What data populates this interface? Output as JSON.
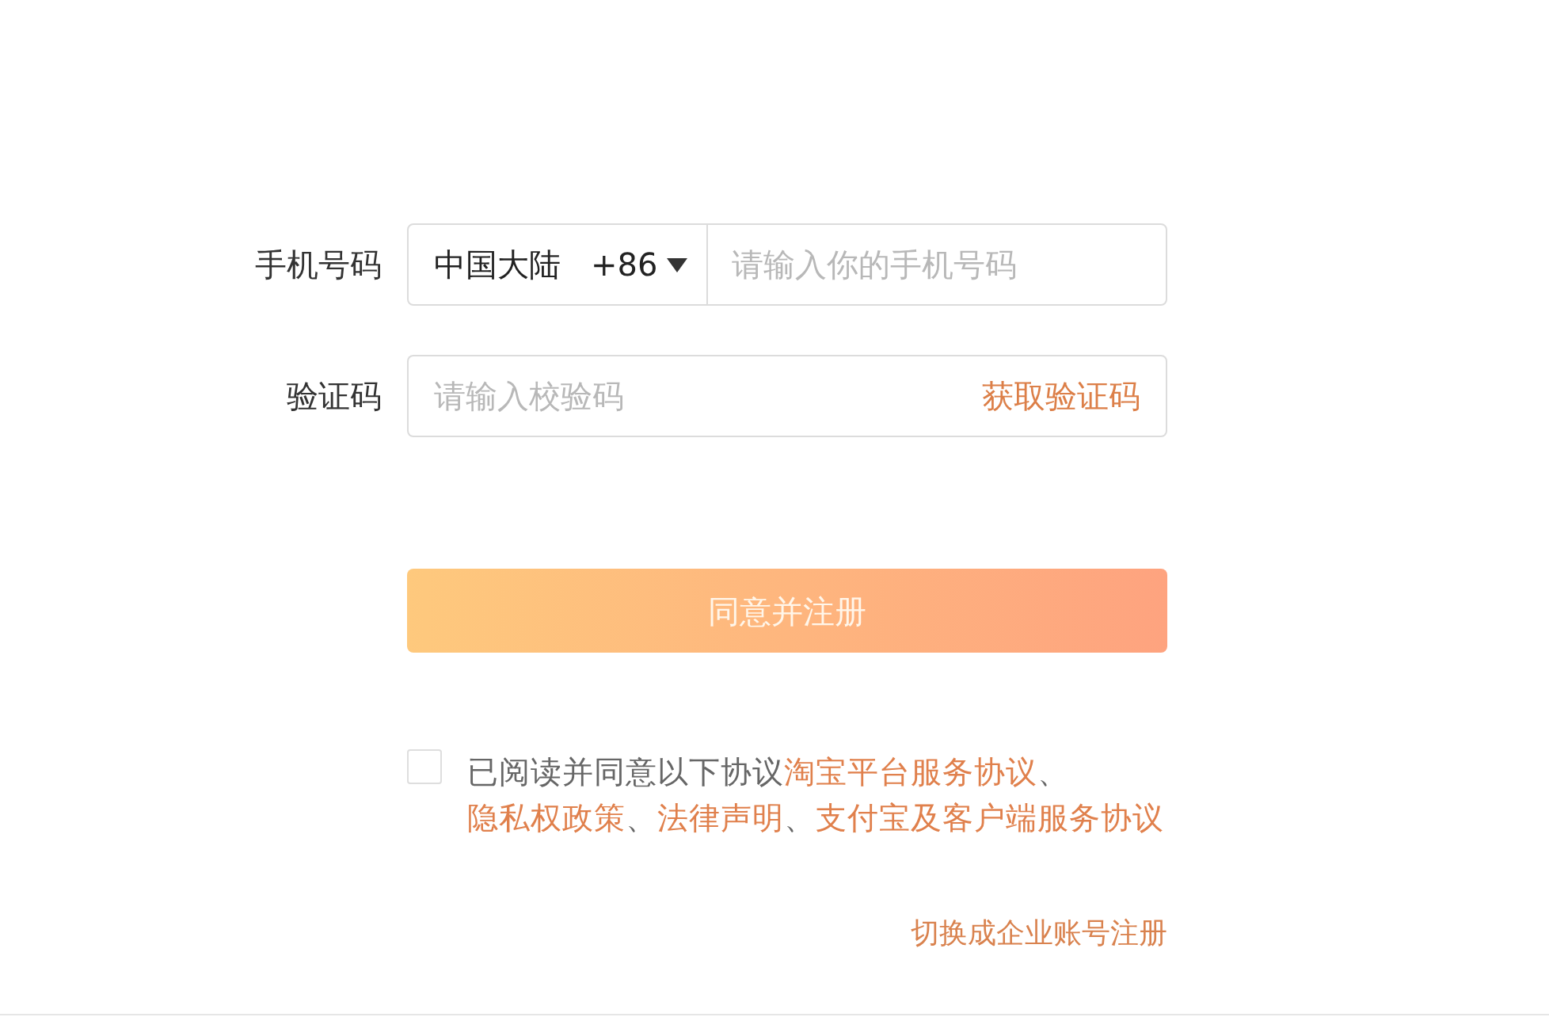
{
  "phone": {
    "label": "手机号码",
    "country": {
      "name": "中国大陆",
      "code": "+86"
    },
    "placeholder": "请输入你的手机号码"
  },
  "verification": {
    "label": "验证码",
    "placeholder": "请输入校验码",
    "action": "获取验证码"
  },
  "submit": {
    "label": "同意并注册"
  },
  "agreement": {
    "checked": false,
    "segments": [
      {
        "kind": "text",
        "text": "已阅读并同意以下协议"
      },
      {
        "kind": "link",
        "text": "淘宝平台服务协议"
      },
      {
        "kind": "text",
        "text": "、"
      },
      {
        "kind": "link",
        "text": "隐私权政策"
      },
      {
        "kind": "text",
        "text": "、"
      },
      {
        "kind": "link",
        "text": "法律声明"
      },
      {
        "kind": "text",
        "text": "、"
      },
      {
        "kind": "link",
        "text": "支付宝及客户端服务协议"
      }
    ]
  },
  "switch_link": "切换成企业账号注册"
}
